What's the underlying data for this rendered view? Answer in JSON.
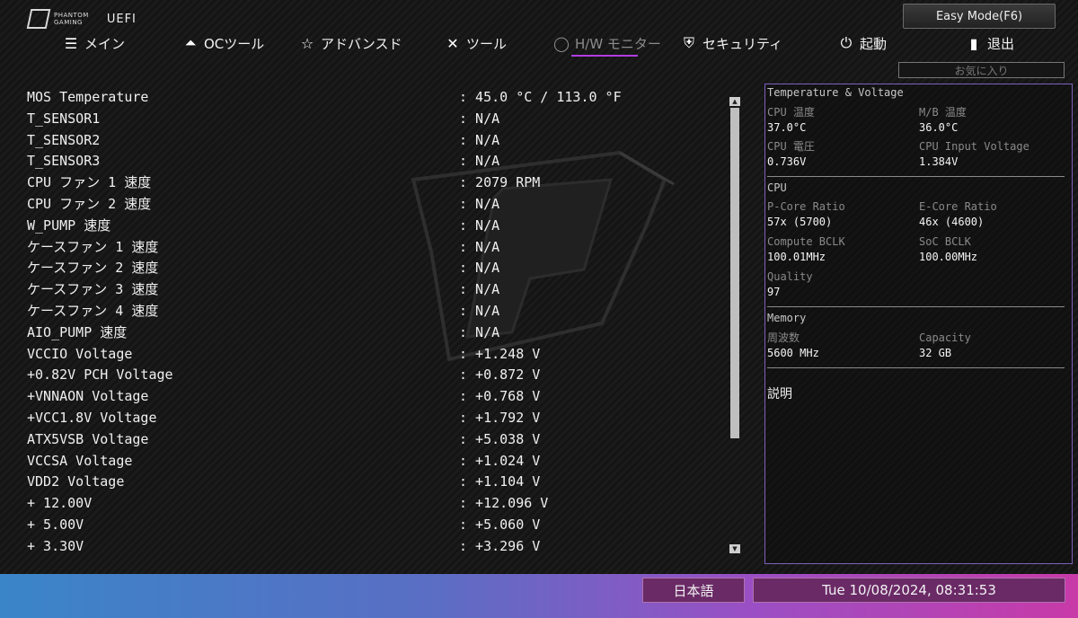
{
  "header": {
    "brand_line1": "PHANTOM",
    "brand_line2": "GAMING",
    "mode": "UEFI",
    "easy_mode_button": "Easy Mode(F6)",
    "favorites": "お気に入り"
  },
  "nav": {
    "tabs": [
      {
        "label": "メイン",
        "icon": "list-icon"
      },
      {
        "label": "OCツール",
        "icon": "rocket-icon"
      },
      {
        "label": "アドバンスド",
        "icon": "star-icon"
      },
      {
        "label": "ツール",
        "icon": "wrench-icon"
      },
      {
        "label": "H/W モニター",
        "icon": "monitor-icon",
        "active": true
      },
      {
        "label": "セキュリティ",
        "icon": "shield-icon"
      },
      {
        "label": "起動",
        "icon": "power-icon"
      },
      {
        "label": "退出",
        "icon": "exit-icon"
      }
    ]
  },
  "monitor": {
    "rows": [
      {
        "label": "MOS Temperature",
        "value": ": 45.0 °C / 113.0 °F"
      },
      {
        "label": "T_SENSOR1",
        "value": ": N/A"
      },
      {
        "label": "T_SENSOR2",
        "value": ": N/A"
      },
      {
        "label": "T_SENSOR3",
        "value": ": N/A"
      },
      {
        "label": "CPU ファン 1 速度",
        "value": ": 2079 RPM"
      },
      {
        "label": "CPU ファン 2 速度",
        "value": ": N/A"
      },
      {
        "label": "W_PUMP 速度",
        "value": ": N/A"
      },
      {
        "label": "ケースファン 1 速度",
        "value": ": N/A"
      },
      {
        "label": "ケースファン 2 速度",
        "value": ": N/A"
      },
      {
        "label": "ケースファン 3 速度",
        "value": ": N/A"
      },
      {
        "label": "ケースファン 4 速度",
        "value": ": N/A"
      },
      {
        "label": "AIO_PUMP 速度",
        "value": ": N/A"
      },
      {
        "label": "VCCIO Voltage",
        "value": ": +1.248 V"
      },
      {
        "label": "+0.82V PCH Voltage",
        "value": ": +0.872 V"
      },
      {
        "label": "+VNNAON Voltage",
        "value": ": +0.768 V"
      },
      {
        "label": "+VCC1.8V Voltage",
        "value": ": +1.792 V"
      },
      {
        "label": "ATX5VSB Voltage",
        "value": ": +5.038 V"
      },
      {
        "label": "VCCSA Voltage",
        "value": ": +1.024 V"
      },
      {
        "label": "VDD2 Voltage",
        "value": ": +1.104 V"
      },
      {
        "label": "+ 12.00V",
        "value": ": +12.096 V"
      },
      {
        "label": "+ 5.00V",
        "value": ": +5.060 V"
      },
      {
        "label": "+ 3.30V",
        "value": ": +3.296 V"
      }
    ]
  },
  "panel": {
    "temp_voltage": {
      "title": "Temperature & Voltage",
      "cpu_temp_label": "CPU 温度",
      "cpu_temp": "37.0°C",
      "mb_temp_label": "M/B 温度",
      "mb_temp": "36.0°C",
      "cpu_voltage_label": "CPU 電圧",
      "cpu_voltage": "0.736V",
      "cpu_input_voltage_label": "CPU Input Voltage",
      "cpu_input_voltage": "1.384V"
    },
    "cpu": {
      "title": "CPU",
      "pcore_label": "P-Core Ratio",
      "pcore": "57x (5700)",
      "ecore_label": "E-Core Ratio",
      "ecore": "46x (4600)",
      "compute_bclk_label": "Compute BCLK",
      "compute_bclk": "100.01MHz",
      "soc_bclk_label": "SoC BCLK",
      "soc_bclk": "100.00MHz",
      "quality_label": "Quality",
      "quality": "97"
    },
    "memory": {
      "title": "Memory",
      "freq_label": "周波数",
      "freq": "5600 MHz",
      "capacity_label": "Capacity",
      "capacity": "32 GB"
    },
    "description_label": "説明"
  },
  "footer": {
    "language": "日本語",
    "datetime": "Tue 10/08/2024, 08:31:53"
  }
}
